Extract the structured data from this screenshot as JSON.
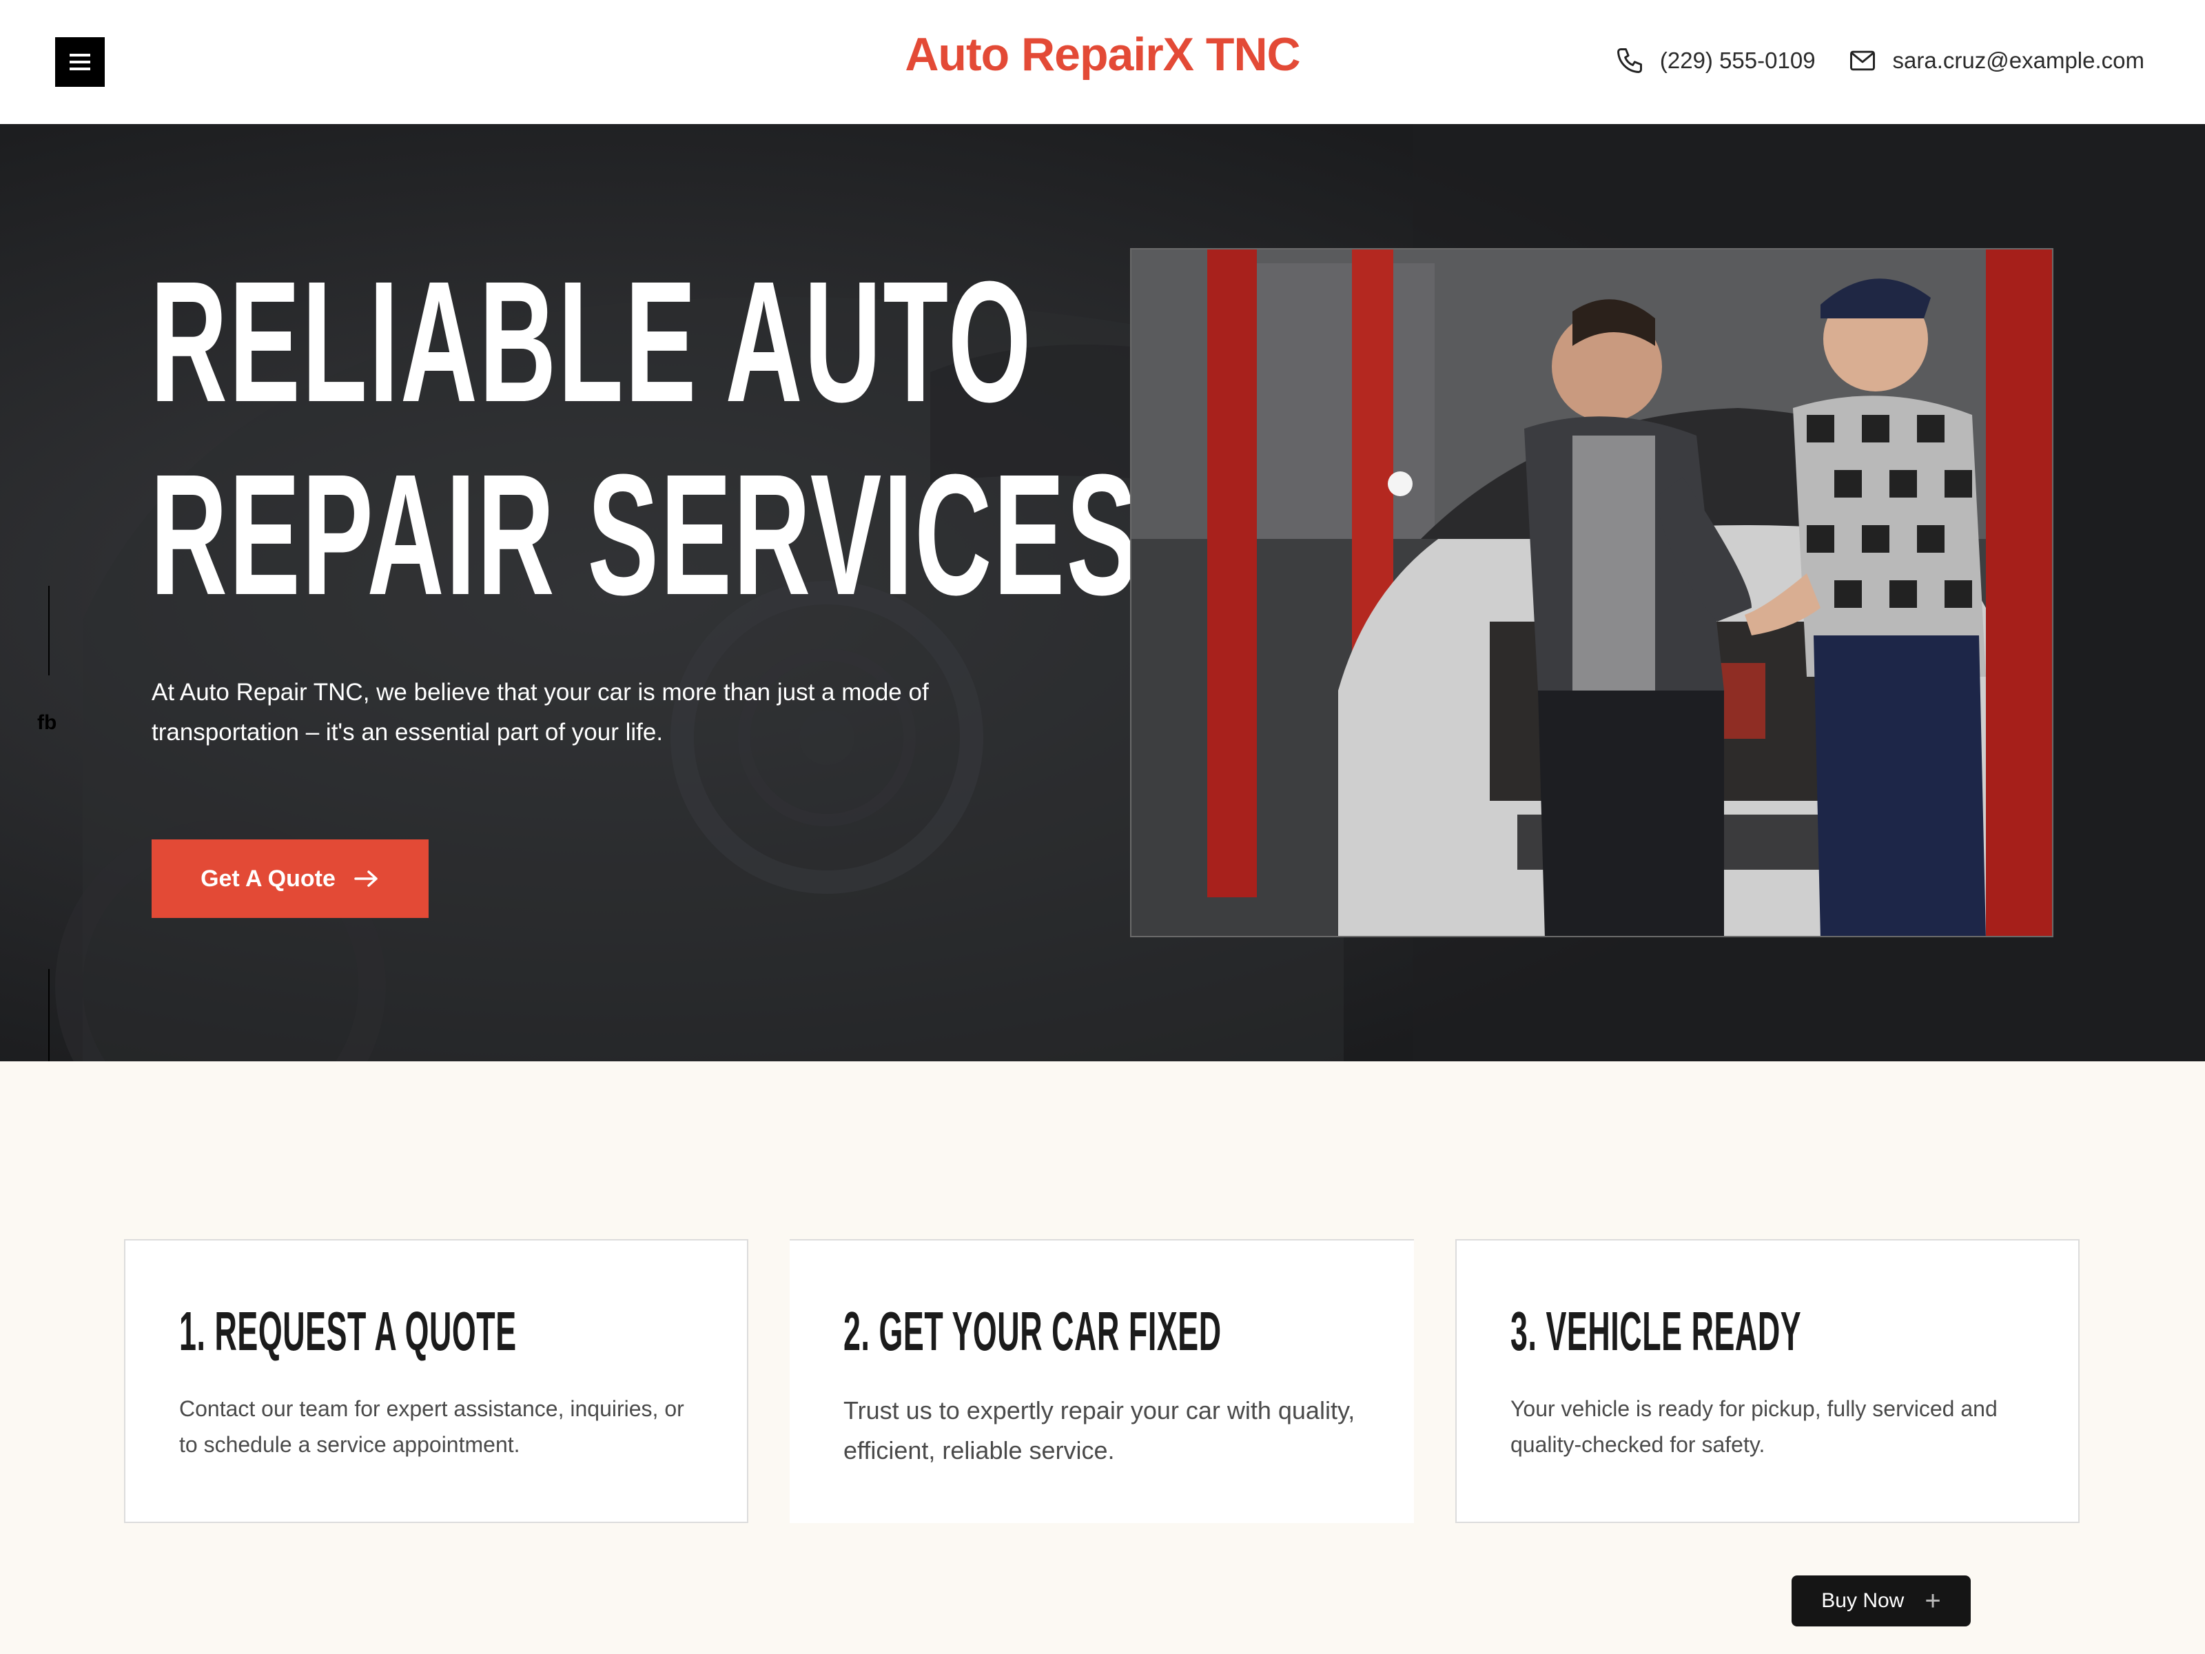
{
  "header": {
    "brand": "Auto RepairX TNC",
    "phone": "(229) 555-0109",
    "email": "sara.cruz@example.com"
  },
  "hero": {
    "title_line1": "RELIABLE AUTO",
    "title_line2": "REPAIR SERVICES",
    "description": "At Auto Repair TNC, we believe that your car is more than just a mode of transportation – it's an essential part of your life.",
    "cta_label": "Get A Quote",
    "side_social": "fb"
  },
  "steps": [
    {
      "title": "1. REQUEST A QUOTE",
      "text": "Contact our team for expert assistance, inquiries, or to schedule a service appointment."
    },
    {
      "title": "2. GET YOUR CAR FIXED",
      "text": "Trust us to expertly repair your car with quality, efficient, reliable service."
    },
    {
      "title": "3. VEHICLE READY",
      "text": "Your vehicle is ready for pickup, fully serviced and quality-checked for safety."
    }
  ],
  "floating": {
    "buy_now_label": "Buy Now"
  },
  "colors": {
    "accent": "#e34a36",
    "hero_bg": "#1e1f21",
    "page_bg": "#fcf9f3"
  },
  "icons": {
    "menu": "hamburger-icon",
    "phone": "phone-icon",
    "email": "envelope-icon",
    "cta": "arrow-right-icon",
    "buy": "plus-icon"
  }
}
